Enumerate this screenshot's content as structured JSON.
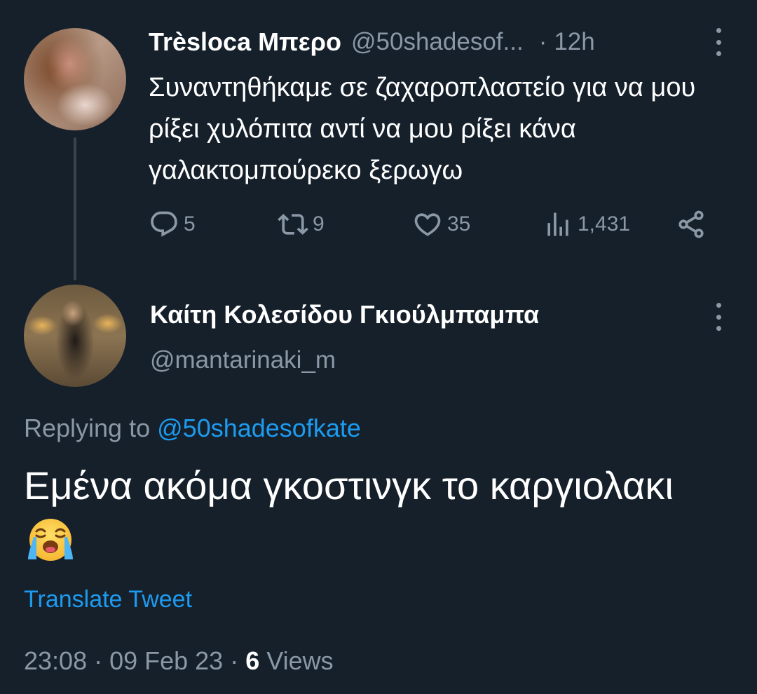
{
  "parent_tweet": {
    "display_name": "Trèsloca Μπερο",
    "handle": "@50shadesof...",
    "separator": "·",
    "time": "12h",
    "text": "Συναντηθήκαμε σε ζαχαροπλαστείο για να μου ρίξει χυλόπιτα αντί να μου ρίξει κάνα γαλακτομπούρεκο ξερωγω",
    "actions": {
      "replies": "5",
      "retweets": "9",
      "likes": "35",
      "views": "1,431"
    }
  },
  "reply_tweet": {
    "display_name": "Καίτη Κολεσίδου Γκιούλμπαμπα",
    "handle": "@mantarinaki_m",
    "replying_prefix": "Replying to",
    "replying_to": "@50shadesofkate",
    "text": "Εμένα ακόμα γκοστινγκ το καργιολακι",
    "emoji": "loudly-crying-face",
    "translate_label": "Translate Tweet",
    "timestamp": "23:08 · 09 Feb 23 · ",
    "views_count": "6",
    "views_label": "Views"
  },
  "colors": {
    "background": "#15202b",
    "secondary_text": "#8b98a5",
    "link": "#1d9bf0",
    "thread_line": "#38444d"
  }
}
